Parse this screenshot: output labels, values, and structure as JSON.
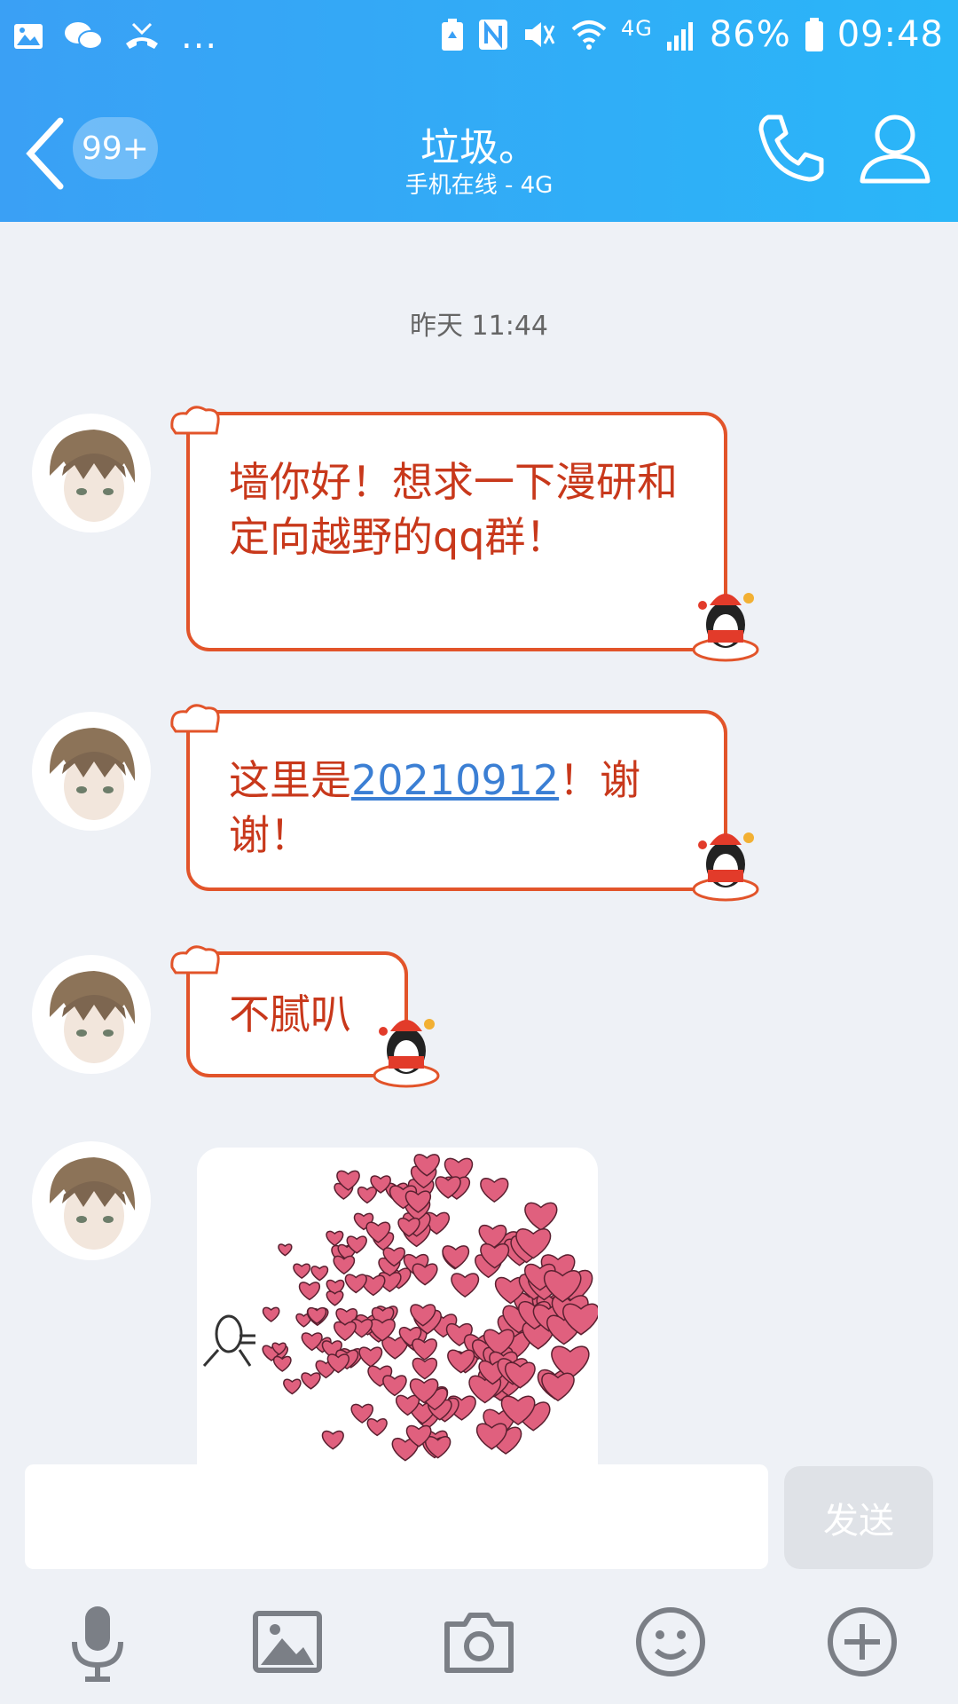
{
  "status_bar": {
    "network_type": "4G",
    "battery_percent": "86%",
    "time": "09:48",
    "more_indicator": "...",
    "left_icons": [
      "gallery-icon",
      "wechat-icon",
      "missed-call-icon"
    ],
    "right_icons": [
      "battery-saver-icon",
      "nfc-icon",
      "mute-icon",
      "wifi-icon",
      "signal-icon",
      "battery-icon"
    ]
  },
  "header": {
    "back_icon": "chevron-left-icon",
    "unread_badge": "99+",
    "title": "垃圾。",
    "subtitle": "手机在线 - 4G",
    "call_icon": "phone-icon",
    "profile_icon": "person-icon"
  },
  "chat": {
    "timestamp": "昨天 11:44",
    "messages": [
      {
        "type": "text",
        "text": "墙你好！想求一下漫研和定向越野的qq群！"
      },
      {
        "type": "text",
        "text_before": "这里是",
        "link": "20210912",
        "text_after": "！谢谢！"
      },
      {
        "type": "text",
        "text": "不腻叭"
      },
      {
        "type": "image",
        "description_icon": "hearts-sticker-icon"
      }
    ]
  },
  "input": {
    "value": "",
    "send_label": "发送"
  },
  "toolbar": {
    "icons": [
      "microphone-icon",
      "image-icon",
      "camera-icon",
      "emoji-icon",
      "plus-icon"
    ]
  },
  "colors": {
    "header_start": "#3aa0f5",
    "header_end": "#2ab6f8",
    "bubble_border": "#e2542a",
    "bubble_text": "#c8381b",
    "link": "#3b7fd4",
    "background": "#eef1f6"
  }
}
